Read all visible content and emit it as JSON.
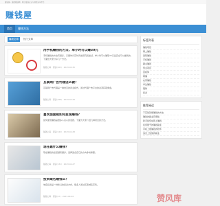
{
  "topbar": {
    "text": "赚钱屋 - 兼职赚钱网 - 网上赚钱方法与项目分享平台"
  },
  "logo": "赚钱屋",
  "nav": [
    {
      "label": "首页"
    },
    {
      "label": "赚钱方法"
    }
  ],
  "tabs": [
    {
      "label": "最新文章"
    },
    {
      "label": "热门文章"
    }
  ],
  "posts": [
    {
      "title": "用手机赚钱的方法，单小时可以赚30元",
      "desc": "手机赚钱的方法有很多，只要你肯花时间去研究和尝试，单小时可以赚取30元是完全可以做到的，下面给大家分享几个方法。",
      "meta": "赚钱心得 · 阅读(203) · 2023-04-30"
    },
    {
      "title": "互联网广告代理怎么做？",
      "desc": "互联网广告代理是一种常见的商业模式，通过代理广告平台的资源获取佣金。",
      "meta": "赚钱心得 · 阅读(168) · 2023-04-29"
    },
    {
      "title": "喜欢面面相如何变现赚钱？",
      "desc": "如何变现赚钱是很多人关心的话题，下面为大家介绍几种常见的方法。",
      "meta": "赚钱心得 · 阅读(142) · 2023-04-28"
    },
    {
      "title": "现在靠什么赚钱？",
      "desc": "现在赚钱的途径越来越多，选择适合自己的方向非常重要。",
      "meta": "赚钱心得 · 阅读(131) · 2023-04-27"
    },
    {
      "title": "投资域名赚钱么？",
      "desc": "域名投资是一种新兴的投资方式，很多人通过买卖域名获利。",
      "meta": "赚钱心得 · 阅读(97) · 2023-04-26"
    }
  ],
  "sidebar": {
    "tags_title": "标签列表",
    "tags": [
      "赚钱项目",
      "网上赚钱",
      "兼职赚钱",
      "手机赚钱",
      "副业赚钱",
      "创业项目",
      "自媒体",
      "网赚",
      "在家赚钱",
      "学生赚钱",
      "理财",
      "投资"
    ],
    "list_title": "推荐阅读",
    "list": [
      "不花钱就能赚钱的方法",
      "赚钱的副业有哪些",
      "新手如何在网上赚钱",
      "在家能干的赚钱副业",
      "手机上能赚钱的软件",
      "适合上班族的副业"
    ]
  },
  "watermark": "赞风库"
}
